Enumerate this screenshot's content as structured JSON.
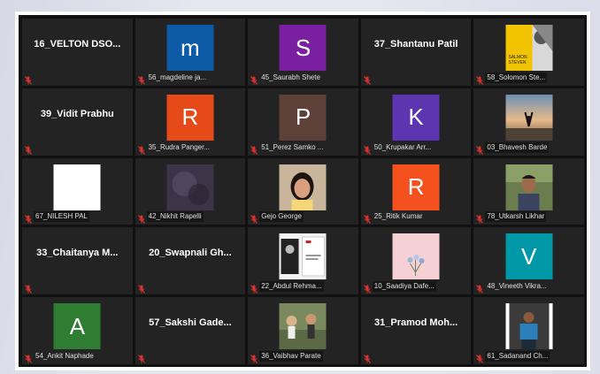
{
  "colors": {
    "muted_mic": "#d9322e",
    "tile_bg": "#232323"
  },
  "tiles": [
    {
      "type": "name",
      "big": "16_VELTON  DSO..."
    },
    {
      "type": "avatar",
      "letter": "m",
      "color": "#0d5aa7",
      "label": "56_magdeline ja..."
    },
    {
      "type": "avatar",
      "letter": "S",
      "color": "#7a1fa2",
      "label": "45_Saurabh Shete"
    },
    {
      "type": "name",
      "big": "37_Shantanu Patil"
    },
    {
      "type": "photo",
      "photo": "book-cover",
      "label": "58_Solomon Ste..."
    },
    {
      "type": "name",
      "big": "39_Vidit Prabhu"
    },
    {
      "type": "avatar",
      "letter": "R",
      "color": "#e64a19",
      "label": "35_Rudra Panger..."
    },
    {
      "type": "avatar",
      "letter": "P",
      "color": "#5d4037",
      "label": "51_Perez Samko ..."
    },
    {
      "type": "avatar",
      "letter": "K",
      "color": "#5e35b1",
      "label": "50_Krupakar Arr..."
    },
    {
      "type": "photo",
      "photo": "sunset",
      "label": "03_Bhavesh Barde"
    },
    {
      "type": "photo",
      "photo": "white",
      "label": "67_NILESH PAL"
    },
    {
      "type": "photo",
      "photo": "blur",
      "label": "42_Nikhit Rapelli"
    },
    {
      "type": "photo",
      "photo": "portrait-girl",
      "label": "Gejo George"
    },
    {
      "type": "avatar",
      "letter": "R",
      "color": "#f4511e",
      "label": "25_Ritik Kumar"
    },
    {
      "type": "photo",
      "photo": "portrait-boy",
      "label": "78_Utkarsh Likhar"
    },
    {
      "type": "name",
      "big": "33_Chaitanya  M..."
    },
    {
      "type": "name",
      "big": "20_Swapnali  Gh..."
    },
    {
      "type": "photo",
      "photo": "book-white",
      "label": "22_Abdul Rehma..."
    },
    {
      "type": "photo",
      "photo": "flowers",
      "label": "10_Saadiya Dafe..."
    },
    {
      "type": "avatar",
      "letter": "V",
      "color": "#0097a7",
      "label": "48_Vineeth Vikra..."
    },
    {
      "type": "avatar",
      "letter": "A",
      "color": "#2e7d32",
      "label": "54_Ankit Naphade"
    },
    {
      "type": "name",
      "big": "57_Sakshi  Gade..."
    },
    {
      "type": "photo",
      "photo": "outdoor",
      "label": "36_Vaibhav Parate"
    },
    {
      "type": "name",
      "big": "31_Pramod  Moh..."
    },
    {
      "type": "photo",
      "photo": "person-blue",
      "label": "61_Sadanand Ch..."
    }
  ]
}
